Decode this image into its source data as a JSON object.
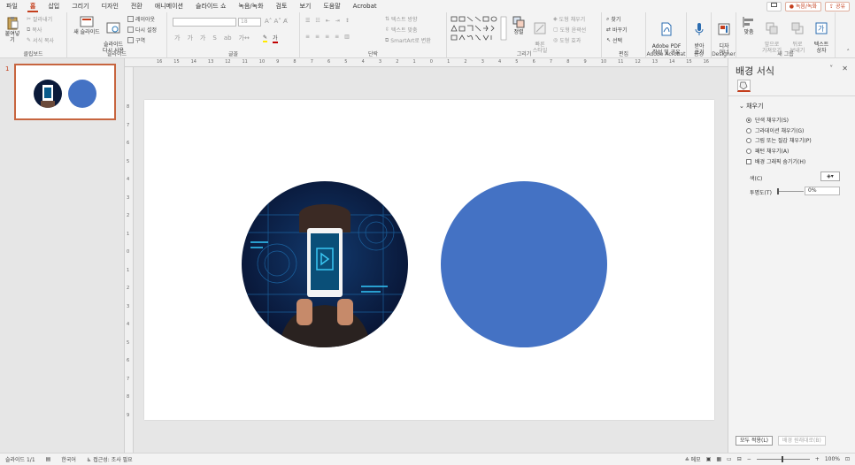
{
  "menu": {
    "tabs": [
      "파일",
      "홈",
      "삽입",
      "그리기",
      "디자인",
      "전환",
      "애니메이션",
      "슬라이드 쇼",
      "녹음/녹화",
      "검토",
      "보기",
      "도움말",
      "Acrobat"
    ],
    "record_label": "녹음/녹화",
    "share_label": "공유"
  },
  "ribbon": {
    "clipboard": {
      "paste": "붙여넣기",
      "cut": "잘라내기",
      "copy": "복사",
      "format_painter": "서식 복사",
      "label": "클립보드"
    },
    "slides": {
      "new_slide": "새 슬라이드",
      "reuse": "슬라이드\n다시 사용",
      "layout": "레이아웃",
      "reset": "다시 설정",
      "section": "구역",
      "label": "슬라이드"
    },
    "font": {
      "label": "글꼴",
      "size": "18"
    },
    "paragraph": {
      "text_direction": "텍스트 방향",
      "align_text": "텍스트 맞춤",
      "smartart": "SmartArt로 변환",
      "label": "단락"
    },
    "drawing": {
      "arrange": "정렬",
      "quick_styles": "빠른\n스타일",
      "shape_fill": "도형 채우기",
      "shape_outline": "도형 윤곽선",
      "shape_effects": "도형 효과",
      "label": "그리기"
    },
    "editing": {
      "find": "찾기",
      "replace": "바꾸기",
      "select": "선택",
      "label": "편집"
    },
    "acrobat": {
      "create": "Adobe PDF\n작성 및 공유",
      "label": "Adobe Acrobat"
    },
    "voice": {
      "dictate": "받아\n쓰기",
      "label": "음성"
    },
    "designer": {
      "ideas": "디자\n이너",
      "label": "Designer"
    },
    "new_group": {
      "align": "맞춤",
      "bring_forward": "앞으로\n가져오기",
      "send_backward": "뒤로\n보내기",
      "text_box": "텍스트\n상자",
      "label": "새 그룹"
    }
  },
  "thumbs": {
    "number": "1"
  },
  "ruler": {
    "top": [
      "16",
      "15",
      "14",
      "13",
      "12",
      "11",
      "10",
      "9",
      "8",
      "7",
      "6",
      "5",
      "4",
      "3",
      "2",
      "1",
      "0",
      "1",
      "2",
      "3",
      "4",
      "5",
      "6",
      "7",
      "8",
      "9",
      "10",
      "11",
      "12",
      "13",
      "14",
      "15",
      "16"
    ],
    "left": [
      "8",
      "7",
      "6",
      "5",
      "4",
      "3",
      "2",
      "1",
      "0",
      "1",
      "2",
      "3",
      "4",
      "5",
      "6",
      "7",
      "8",
      "9"
    ]
  },
  "pane": {
    "title": "배경 서식",
    "section": "채우기",
    "options": [
      {
        "label": "단색 채우기(S)",
        "selected": true
      },
      {
        "label": "그라데이션 채우기(G)",
        "selected": false
      },
      {
        "label": "그림 또는 질감 채우기(P)",
        "selected": false
      },
      {
        "label": "패턴 채우기(A)",
        "selected": false
      }
    ],
    "hide_graphics": "배경 그래픽 숨기기(H)",
    "color_label": "색(C)",
    "transparency_label": "투명도(T)",
    "transparency_value": "0%",
    "apply_all": "모두 적용(L)",
    "reset_bg": "배경 원래대로(B)"
  },
  "slide": {
    "circle_fill": "#4472c4"
  },
  "status": {
    "slide": "슬라이드 1/1",
    "language": "한국어",
    "accessibility": "접근성: 조사 필요",
    "notes": "메모",
    "zoom": "100%"
  },
  "colors": {
    "accent": "#c43e1c",
    "shape_blue": "#4472c4",
    "photo_dark": "#0b1a3a"
  }
}
